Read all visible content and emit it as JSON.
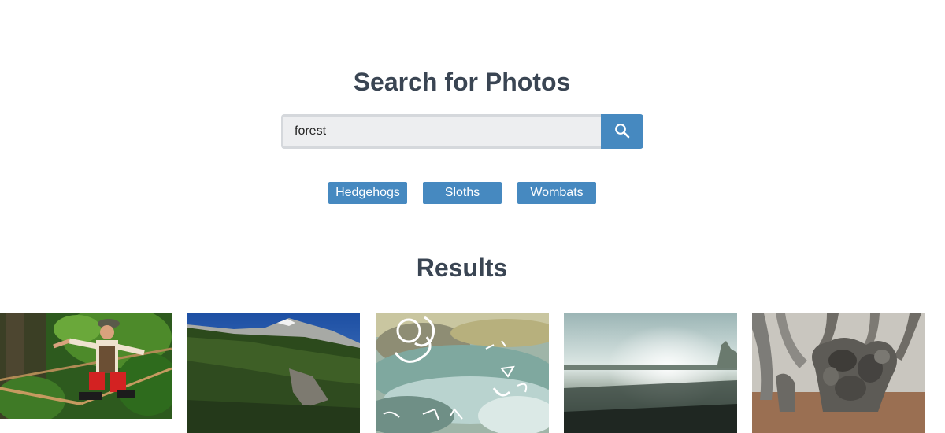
{
  "header": {
    "title": "Search for Photos"
  },
  "search": {
    "value": "forest",
    "button_icon": "search-icon"
  },
  "tags": [
    {
      "label": "Hedgehogs"
    },
    {
      "label": "Sloths"
    },
    {
      "label": "Wombats"
    }
  ],
  "results": {
    "title": "Results",
    "photos": [
      {
        "subject": "person balancing on slackline in forest"
      },
      {
        "subject": "forested mountain slope under blue sky"
      },
      {
        "subject": "clear stream over rocks with doodles"
      },
      {
        "subject": "misty field at sunrise"
      },
      {
        "subject": "gnarled beech tree trunks"
      }
    ]
  },
  "colors": {
    "accent": "#4689c0",
    "heading": "#3a4553",
    "input_bg": "#edeef0",
    "input_border": "#d5d8dc"
  }
}
